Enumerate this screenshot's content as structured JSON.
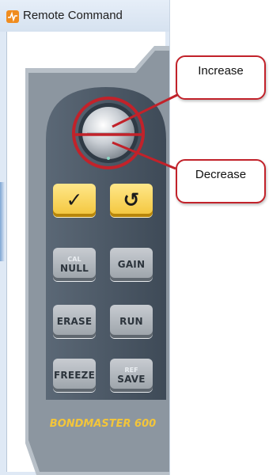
{
  "window": {
    "title": "Remote Command",
    "icon": "pulse-icon"
  },
  "knob": {
    "icon": "rotary-knob-icon"
  },
  "buttons": {
    "check": {
      "glyph": "✓",
      "icon": "check-icon"
    },
    "back": {
      "glyph": "↺",
      "icon": "back-arrow-icon"
    },
    "null": {
      "sub": "CAL",
      "label": "NULL"
    },
    "gain": {
      "label": "GAIN"
    },
    "erase": {
      "label": "ERASE"
    },
    "run": {
      "label": "RUN"
    },
    "freeze": {
      "label": "FREEZE"
    },
    "save": {
      "sub": "REF",
      "label": "SAVE"
    }
  },
  "brand": "BONDMASTER 600",
  "callouts": {
    "increase": "Increase",
    "decrease": "Decrease"
  },
  "colors": {
    "panel": "#4b5866",
    "panel_light": "#6a7784",
    "accent_red": "#c2222a",
    "key_yellow": "#f3c53a",
    "key_gray": "#a7adb3",
    "brand_yellow": "#f3c53a"
  }
}
